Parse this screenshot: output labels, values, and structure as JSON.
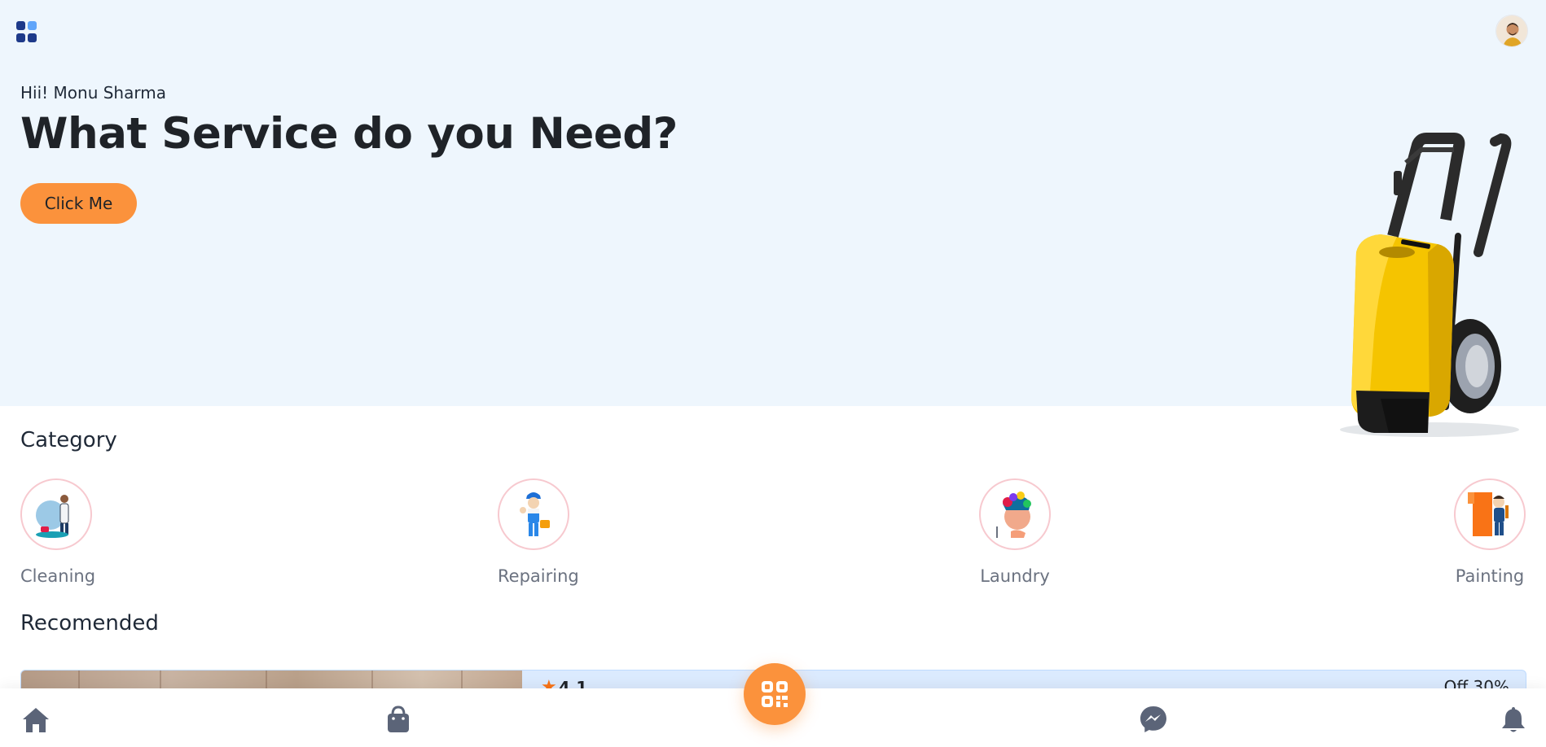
{
  "header": {
    "menu_icon": "grid-menu-icon",
    "avatar_icon": "user-avatar"
  },
  "hero": {
    "greeting": "Hii! Monu Sharma",
    "headline": "What Service do you Need?",
    "cta_label": "Click Me",
    "illustration": "pressure-washer"
  },
  "category": {
    "title": "Category",
    "items": [
      {
        "label": "Cleaning",
        "icon": "cleaning-worker-icon"
      },
      {
        "label": "Repairing",
        "icon": "repair-worker-icon"
      },
      {
        "label": "Laundry",
        "icon": "laundry-icon"
      },
      {
        "label": "Painting",
        "icon": "painter-icon"
      }
    ]
  },
  "recommended": {
    "title": "Recomended",
    "card": {
      "rating": "4.1",
      "offer": "Off 30%"
    }
  },
  "bottom_nav": {
    "items": [
      "home-icon",
      "shopping-bag-icon",
      "qr-scan-icon",
      "messenger-icon",
      "bell-icon"
    ]
  },
  "colors": {
    "accent": "#fb923c",
    "hero_bg": "#eef6fd",
    "icon_gray": "#6b7280"
  }
}
